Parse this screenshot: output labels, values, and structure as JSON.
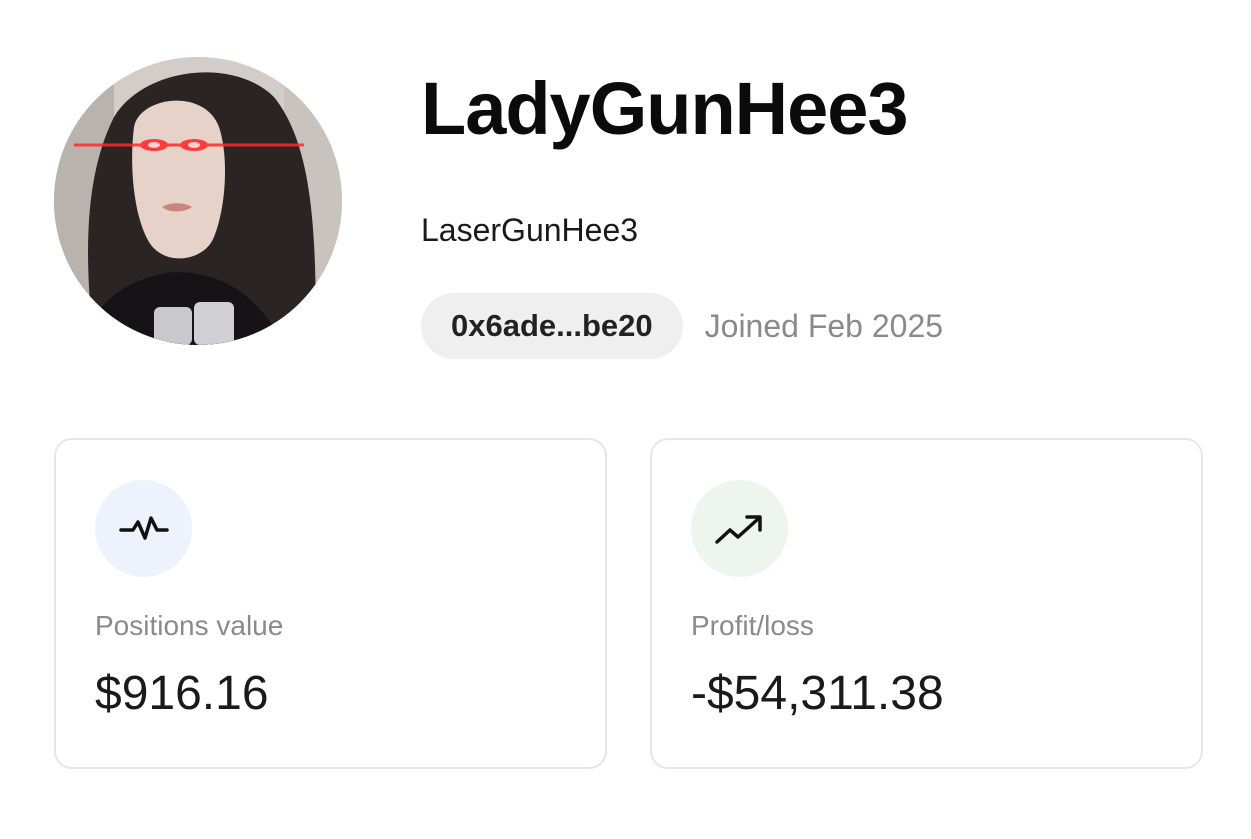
{
  "profile": {
    "username": "LadyGunHee3",
    "display_name": "LaserGunHee3",
    "address": "0x6ade...be20",
    "joined": "Joined Feb 2025",
    "avatar_description": "profile-avatar"
  },
  "stats": [
    {
      "label": "Positions value",
      "value": "$916.16",
      "icon": "activity-icon",
      "icon_bg": "#eef2fd"
    },
    {
      "label": "Profit/loss",
      "value": "-$54,311.38",
      "icon": "trending-up-icon",
      "icon_bg": "#eef5ee"
    }
  ]
}
